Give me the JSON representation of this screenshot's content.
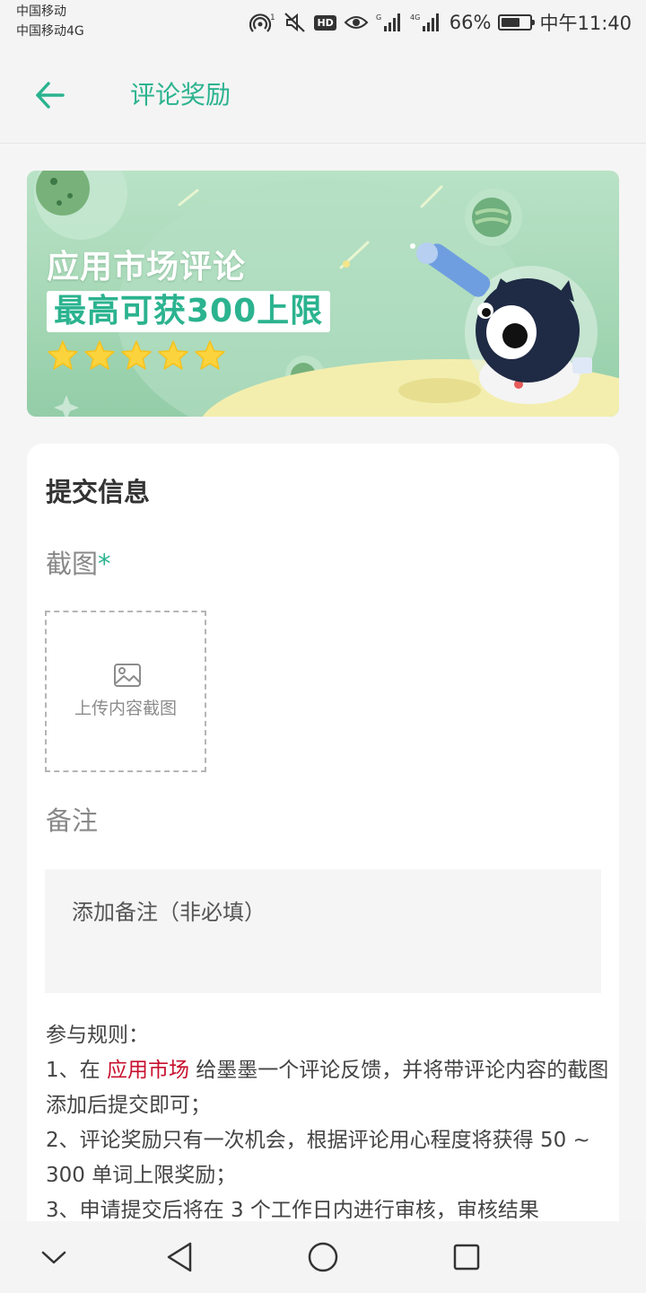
{
  "status_bar": {
    "carrier_1": "中国移动",
    "carrier_2": "中国移动4G",
    "hd": "HD",
    "battery": "66%",
    "battery_level": 0.66,
    "time": "中午11:40"
  },
  "app_bar": {
    "back_icon": "arrow-left-icon",
    "title": "评论奖励"
  },
  "banner": {
    "line1": "应用市场评论",
    "line2": "最高可获300上限",
    "stars": 5,
    "accent": "#2bb38f"
  },
  "form": {
    "section_title": "提交信息",
    "screenshot_label": "截图",
    "required_mark": "*",
    "upload_label": "上传内容截图",
    "remark_label": "备注",
    "remark_placeholder": "添加备注（非必填）",
    "remark_value": ""
  },
  "rules": {
    "title": "参与规则：",
    "r1_prefix": "1、在 ",
    "r1_highlight": "应用市场",
    "r1_suffix": " 给墨墨一个评论反馈，并将带评论内容的截图添加后提交即可；",
    "r2": "2、评论奖励只有一次机会，根据评论用心程度将获得 50 ~ 300 单词上限奖励；",
    "r3": "3、申请提交后将在 3 个工作日内进行审核，审核结果"
  },
  "nav_bar": {
    "items": [
      "chevron-down-icon",
      "back-triangle-icon",
      "home-circle-icon",
      "recents-square-icon"
    ]
  },
  "colors": {
    "accent": "#2bb38f",
    "highlight": "#c8102e"
  }
}
